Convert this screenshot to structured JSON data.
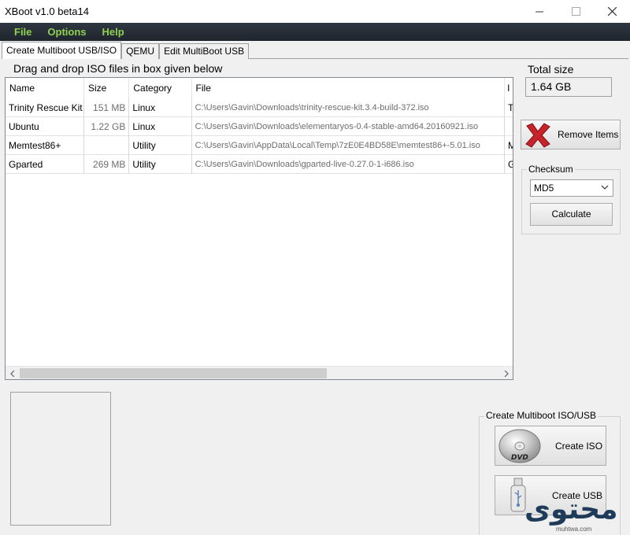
{
  "window": {
    "title": "XBoot v1.0 beta14"
  },
  "menu": {
    "items": [
      {
        "label": "File"
      },
      {
        "label": "Options"
      },
      {
        "label": "Help"
      }
    ]
  },
  "tabs": [
    {
      "label": "Create Multiboot USB/ISO",
      "active": true
    },
    {
      "label": "QEMU",
      "active": false
    },
    {
      "label": "Edit MultiBoot USB",
      "active": false
    }
  ],
  "main": {
    "drag_label": "Drag and drop ISO files in box given below",
    "table": {
      "headers": [
        "Name",
        "Size",
        "Category",
        "File",
        "I"
      ],
      "rows": [
        {
          "name": "Trinity Rescue Kit",
          "size": "151 MB",
          "category": "Linux",
          "file": "C:\\Users\\Gavin\\Downloads\\trinity-rescue-kit.3.4-build-372.iso",
          "extra": "T"
        },
        {
          "name": "Ubuntu",
          "size": "1.22 GB",
          "category": "Linux",
          "file": "C:\\Users\\Gavin\\Downloads\\elementaryos-0.4-stable-amd64.20160921.iso",
          "extra": ""
        },
        {
          "name": "Memtest86+",
          "size": "",
          "category": "Utility",
          "file": "C:\\Users\\Gavin\\AppData\\Local\\Temp\\7zE0E4BD58E\\memtest86+-5.01.iso",
          "extra": "M"
        },
        {
          "name": "Gparted",
          "size": "269 MB",
          "category": "Utility",
          "file": "C:\\Users\\Gavin\\Downloads\\gparted-live-0.27.0-1-i686.iso",
          "extra": "G"
        }
      ]
    }
  },
  "sidebar": {
    "total_size_label": "Total size",
    "total_size_value": "1.64 GB",
    "remove_label": "Remove Items",
    "checksum_label": "Checksum",
    "checksum_value": "MD5",
    "calculate_label": "Calculate"
  },
  "create": {
    "group_label": "Create Multiboot ISO/USB",
    "iso_label": "Create ISO",
    "usb_label": "Create USB"
  },
  "watermark": {
    "text": "محتوى",
    "url": "muhtwa.com"
  },
  "colors": {
    "menu_text": "#8fd14f",
    "menu_bg": "#2f3742",
    "remove_x": "#c8232a"
  }
}
